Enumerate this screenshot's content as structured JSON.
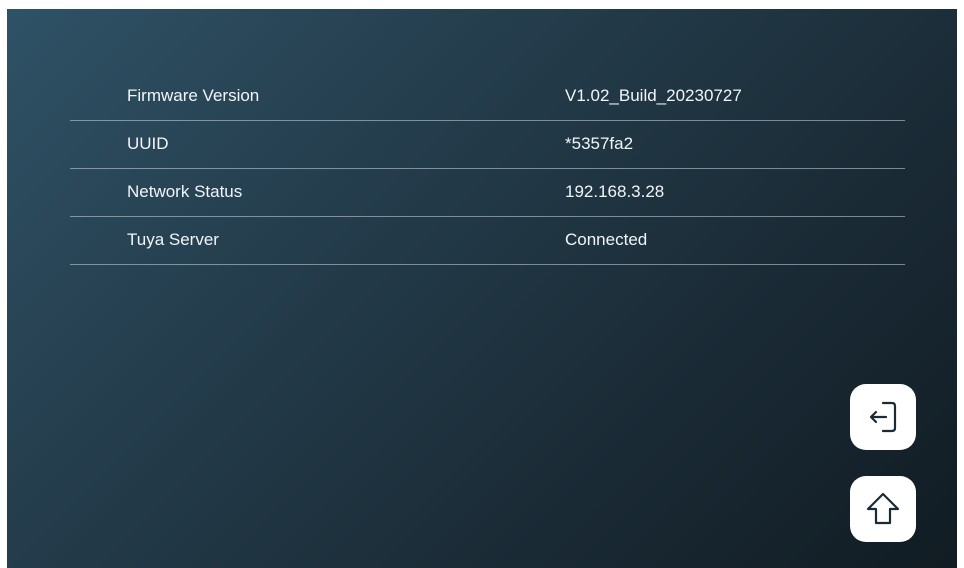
{
  "info": {
    "rows": [
      {
        "label": "Firmware Version",
        "value": "V1.02_Build_20230727"
      },
      {
        "label": "UUID",
        "value": "*5357fa2"
      },
      {
        "label": "Network Status",
        "value": "192.168.3.28"
      },
      {
        "label": "Tuya Server",
        "value": "Connected"
      }
    ]
  },
  "buttons": {
    "back_icon": "exit-arrow-icon",
    "home_icon": "home-icon"
  },
  "colors": {
    "text": "#f2f5f7",
    "button_bg": "#ffffff",
    "icon": "#1b2b35"
  }
}
